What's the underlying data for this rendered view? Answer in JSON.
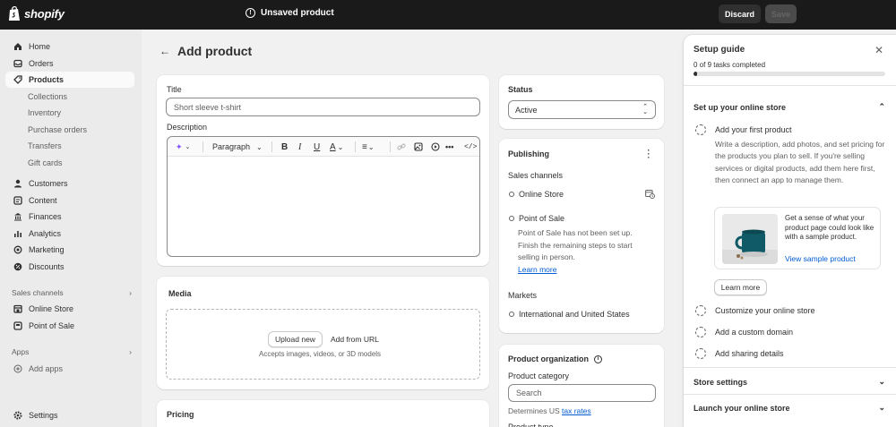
{
  "topbar": {
    "brand": "shopify",
    "status": "Unsaved product",
    "discard": "Discard",
    "save": "Save"
  },
  "sidebar": {
    "items": [
      {
        "label": "Home",
        "icon": "home-icon"
      },
      {
        "label": "Orders",
        "icon": "inbox-icon"
      },
      {
        "label": "Products",
        "icon": "tag-icon"
      },
      {
        "label": "Customers",
        "icon": "person-icon"
      },
      {
        "label": "Content",
        "icon": "content-icon"
      },
      {
        "label": "Finances",
        "icon": "bank-icon"
      },
      {
        "label": "Analytics",
        "icon": "bar-chart-icon"
      },
      {
        "label": "Marketing",
        "icon": "target-icon"
      },
      {
        "label": "Discounts",
        "icon": "discount-icon"
      }
    ],
    "product_sub": [
      "Collections",
      "Inventory",
      "Purchase orders",
      "Transfers",
      "Gift cards"
    ],
    "sales_channels_label": "Sales channels",
    "channels": [
      {
        "label": "Online Store",
        "icon": "store-icon"
      },
      {
        "label": "Point of Sale",
        "icon": "pos-icon"
      }
    ],
    "apps_label": "Apps",
    "add_apps": "Add apps",
    "settings": "Settings"
  },
  "page": {
    "title": "Add product"
  },
  "product_card": {
    "title_label": "Title",
    "title_placeholder": "Short sleeve t-shirt",
    "description_label": "Description",
    "paragraph": "Paragraph",
    "bold": "B",
    "italic": "I",
    "underline": "U",
    "text_color": "A"
  },
  "media": {
    "label": "Media",
    "upload": "Upload new",
    "add_url": "Add from URL",
    "hint": "Accepts images, videos, or 3D models"
  },
  "pricing": {
    "label": "Pricing"
  },
  "status_card": {
    "label": "Status",
    "value": "Active"
  },
  "publishing": {
    "label": "Publishing",
    "sales_channels": "Sales channels",
    "online_store": "Online Store",
    "pos": "Point of Sale",
    "pos_note": "Point of Sale has not been set up. Finish the remaining steps to start selling in person.",
    "learn_more": "Learn more",
    "markets": "Markets",
    "markets_value": "International and United States"
  },
  "organization": {
    "label": "Product organization",
    "category_label": "Product category",
    "search_placeholder": "Search",
    "determines": "Determines US",
    "tax_rates": "tax rates",
    "product_type": "Product type"
  },
  "guide": {
    "title": "Setup guide",
    "progress_text": "0 of 9 tasks completed",
    "progress": 0.02,
    "section_store": "Set up your online store",
    "task_first": "Add your first product",
    "task_first_desc": "Write a description, add photos, and set pricing for the products you plan to sell. If you're selling services or digital products, add them here first, then connect an app to manage them.",
    "promo_text": "Get a sense of what your product page could look like with a sample product.",
    "promo_link": "View sample product",
    "learn_more": "Learn more",
    "task_customize": "Customize your online store",
    "task_domain": "Add a custom domain",
    "task_sharing": "Add sharing details",
    "section_settings": "Store settings",
    "section_launch": "Launch your online store"
  }
}
